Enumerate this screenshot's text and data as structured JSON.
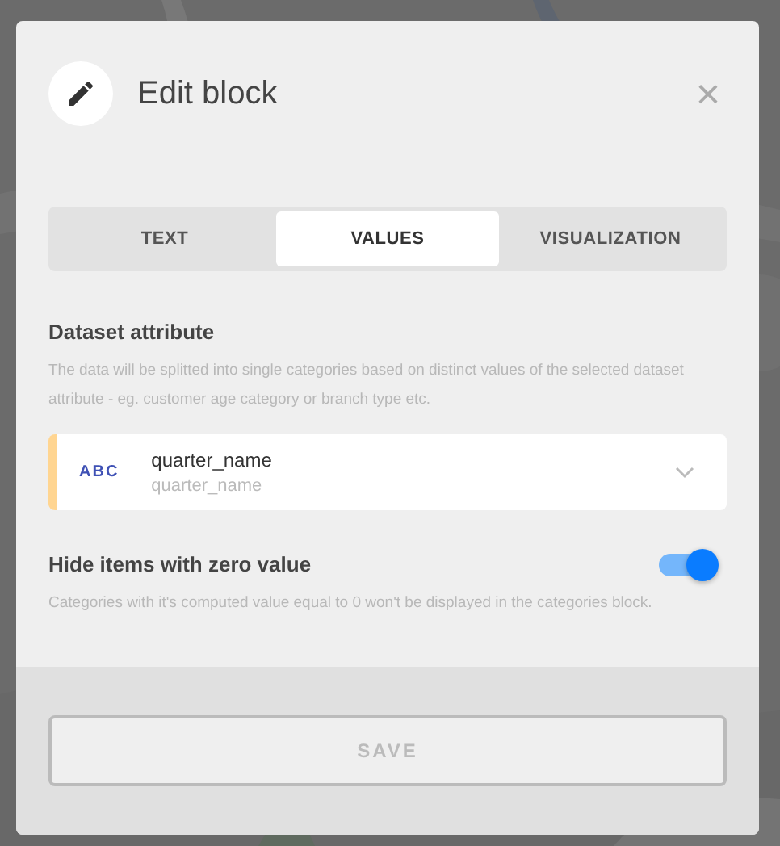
{
  "dialog": {
    "title": "Edit block",
    "close": "×",
    "tabs": [
      {
        "label": "TEXT",
        "selected": false
      },
      {
        "label": "VALUES",
        "selected": true
      },
      {
        "label": "VISUALIZATION",
        "selected": false
      }
    ],
    "dataset_attribute": {
      "label": "Dataset attribute",
      "description": "The data will be splitted into single categories based on distinct values of the selected dataset attribute - eg. customer age category or branch type etc.",
      "select": {
        "type_badge": "ABC",
        "value": "quarter_name",
        "sub_value": "quarter_name"
      }
    },
    "hide_zero": {
      "label": "Hide items with zero value",
      "on": true,
      "description": "Categories with it's computed value equal to 0 won't be displayed in the categories block."
    },
    "save_button": {
      "label": "SAVE",
      "disabled": true
    }
  }
}
